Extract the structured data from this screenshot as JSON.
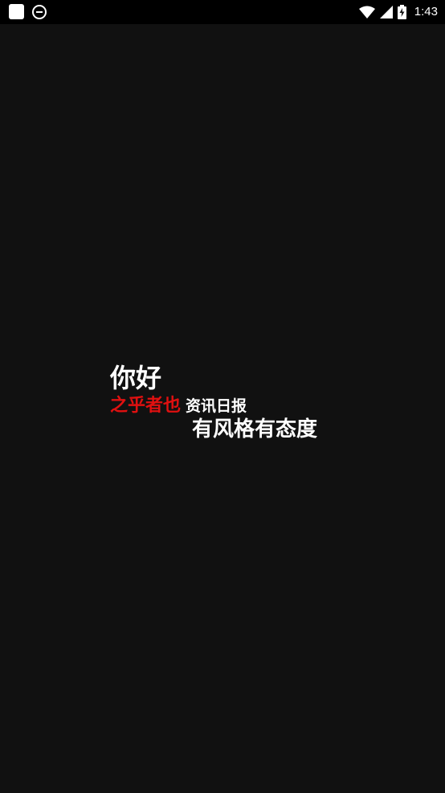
{
  "status_bar": {
    "time": "1:43",
    "icons": [
      "app-square-icon",
      "circle-app-icon",
      "wifi-icon",
      "cell-signal-icon",
      "battery-charging-icon"
    ]
  },
  "splash": {
    "greeting": "你好",
    "brand_red": "之乎者也",
    "brand_white": "资讯日报",
    "slogan": "有风格有态度"
  },
  "colors": {
    "background": "#111111",
    "status_bar": "#000000",
    "accent_red": "#e01010",
    "text": "#ffffff"
  }
}
